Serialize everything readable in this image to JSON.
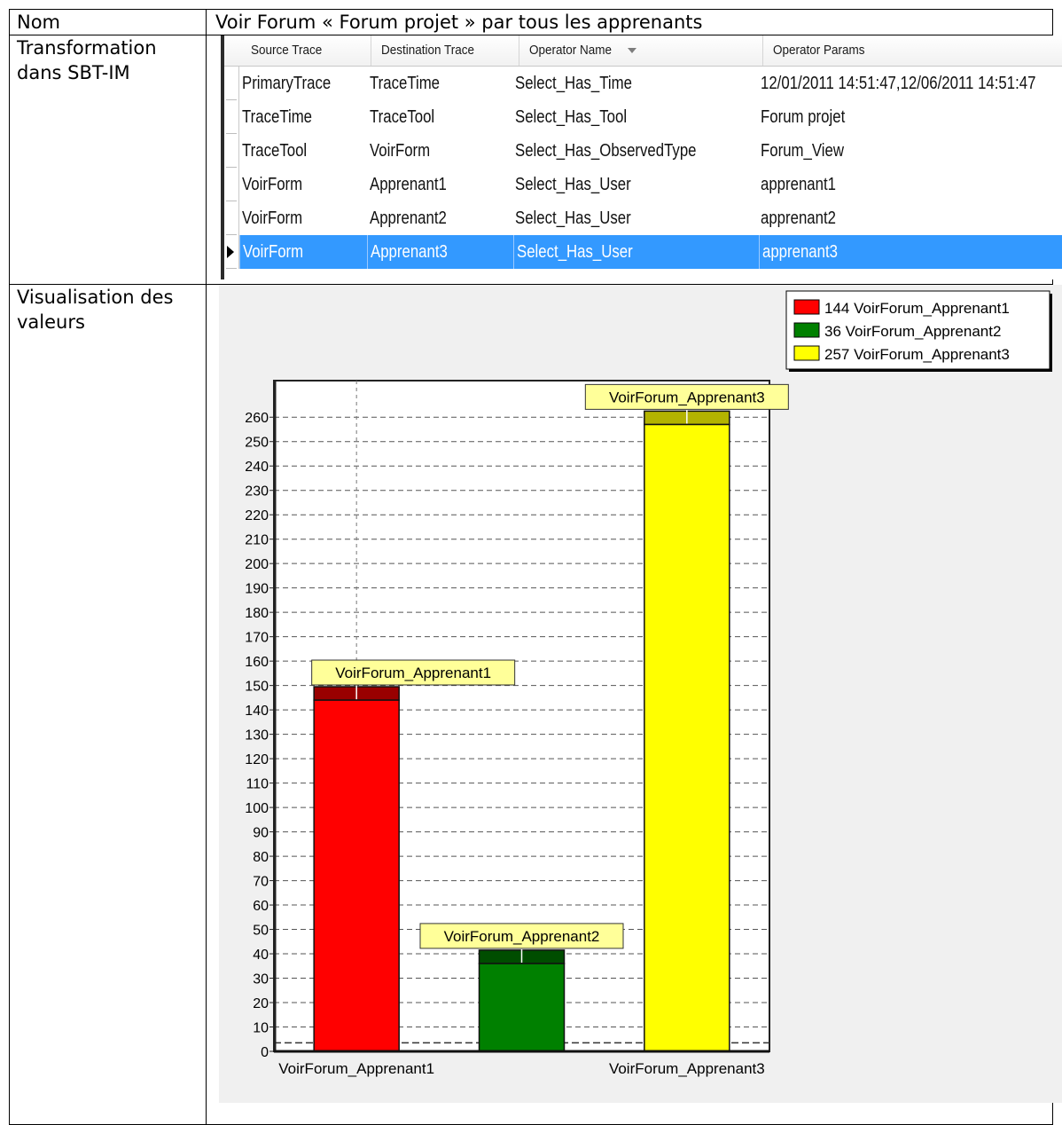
{
  "row_name": {
    "label": "Nom",
    "value": "Voir Forum « Forum projet » par tous les apprenants"
  },
  "row_transformation": {
    "label": "Transformation dans SBT-IM",
    "columns": [
      "Source Trace",
      "Destination Trace",
      "Operator Name",
      "Operator Params"
    ],
    "rows": [
      [
        "PrimaryTrace",
        "TraceTime",
        "Select_Has_Time",
        "12/01/2011 14:51:47,12/06/2011 14:51:47"
      ],
      [
        "TraceTime",
        "TraceTool",
        "Select_Has_Tool",
        "Forum projet"
      ],
      [
        "TraceTool",
        "VoirForm",
        "Select_Has_ObservedType",
        "Forum_View"
      ],
      [
        "VoirForm",
        "Apprenant1",
        "Select_Has_User",
        "apprenant1"
      ],
      [
        "VoirForm",
        "Apprenant2",
        "Select_Has_User",
        "apprenant2"
      ],
      [
        "VoirForm",
        "Apprenant3",
        "Select_Has_User",
        "apprenant3"
      ]
    ],
    "selected_row": 5,
    "sort_icon": "chevron-down-icon"
  },
  "row_visualisation": {
    "label": "Visualisation des valeurs"
  },
  "chart_data": {
    "type": "bar",
    "categories": [
      "VoirForum_Apprenant1",
      "VoirForum_Apprenant2",
      "VoirForum_Apprenant3"
    ],
    "values": [
      144,
      36,
      257
    ],
    "colors": [
      "#ff0000",
      "#008000",
      "#ffff00"
    ],
    "top_colors": [
      "#990000",
      "#004d00",
      "#b3b300"
    ],
    "legend": [
      "144 VoirForum_Apprenant1",
      "36 VoirForum_Apprenant2",
      "257 VoirForum_Apprenant3"
    ],
    "legend_position": "top-right",
    "x_tick_labels": [
      "VoirForum_Apprenant1",
      "VoirForum_Apprenant3"
    ],
    "bar_labels": [
      "VoirForum_Apprenant1",
      "VoirForum_Apprenant2",
      "VoirForum_Apprenant3"
    ],
    "y_ticks": [
      0,
      10,
      20,
      30,
      40,
      50,
      60,
      70,
      80,
      90,
      100,
      110,
      120,
      130,
      140,
      150,
      160,
      170,
      180,
      190,
      200,
      210,
      220,
      230,
      240,
      250,
      260
    ],
    "ylim": [
      0,
      275
    ],
    "grid": true,
    "grid_style": "dashed",
    "title": "",
    "xlabel": "",
    "ylabel": ""
  }
}
